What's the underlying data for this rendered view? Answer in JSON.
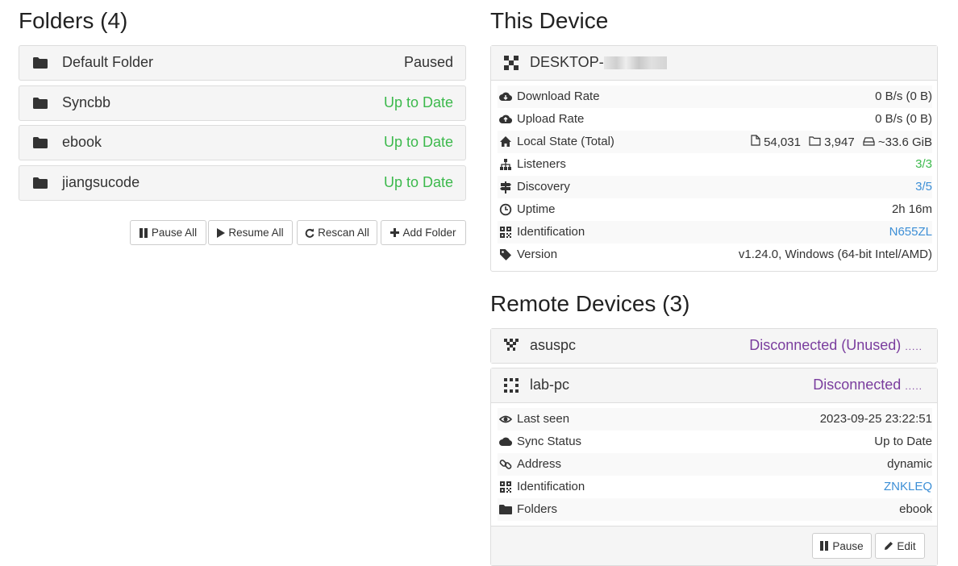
{
  "folders_heading": "Folders (4)",
  "folders": [
    {
      "name": "Default Folder",
      "status": "Paused",
      "status_color": "#333333"
    },
    {
      "name": "Syncbb",
      "status": "Up to Date",
      "status_color": "#3cb94c"
    },
    {
      "name": "ebook",
      "status": "Up to Date",
      "status_color": "#3cb94c"
    },
    {
      "name": "jiangsucode",
      "status": "Up to Date",
      "status_color": "#3cb94c"
    }
  ],
  "folder_buttons": {
    "pause_all": "Pause All",
    "resume_all": "Resume All",
    "rescan_all": "Rescan All",
    "add_folder": "Add Folder"
  },
  "this_device": {
    "heading": "This Device",
    "name": "DESKTOP-",
    "rows": [
      {
        "icon": "cloud-download-icon",
        "label": "Download Rate",
        "value": "0 B/s (0 B)"
      },
      {
        "icon": "cloud-upload-icon",
        "label": "Upload Rate",
        "value": "0 B/s (0 B)"
      },
      {
        "icon": "home-icon",
        "label": "Local State (Total)",
        "files": "54,031",
        "dirs": "3,947",
        "size": "~33.6 GiB"
      },
      {
        "icon": "sitemap-icon",
        "label": "Listeners",
        "value": "3/3"
      },
      {
        "icon": "signpost-icon",
        "label": "Discovery",
        "value": "3/5"
      },
      {
        "icon": "clock-icon",
        "label": "Uptime",
        "value": "2h 16m"
      },
      {
        "icon": "qrcode-icon",
        "label": "Identification",
        "value": "N655ZL"
      },
      {
        "icon": "tag-icon",
        "label": "Version",
        "value": "v1.24.0, Windows (64-bit Intel/AMD)"
      }
    ]
  },
  "remote": {
    "heading": "Remote Devices (3)",
    "devices": [
      {
        "name": "asuspc",
        "status": "Disconnected (Unused)",
        "dots": "....."
      },
      {
        "name": "lab-pc",
        "status": "Disconnected",
        "dots": "....."
      }
    ],
    "lab_rows": [
      {
        "icon": "eye-icon",
        "label": "Last seen",
        "value": "2023-09-25 23:22:51"
      },
      {
        "icon": "cloud-icon",
        "label": "Sync Status",
        "value": "Up to Date"
      },
      {
        "icon": "link-icon",
        "label": "Address",
        "value": "dynamic"
      },
      {
        "icon": "qrcode-icon",
        "label": "Identification",
        "value": "ZNKLEQ"
      },
      {
        "icon": "folder-icon",
        "label": "Folders",
        "value": "ebook"
      }
    ],
    "buttons": {
      "pause": "Pause",
      "edit": "Edit"
    }
  }
}
